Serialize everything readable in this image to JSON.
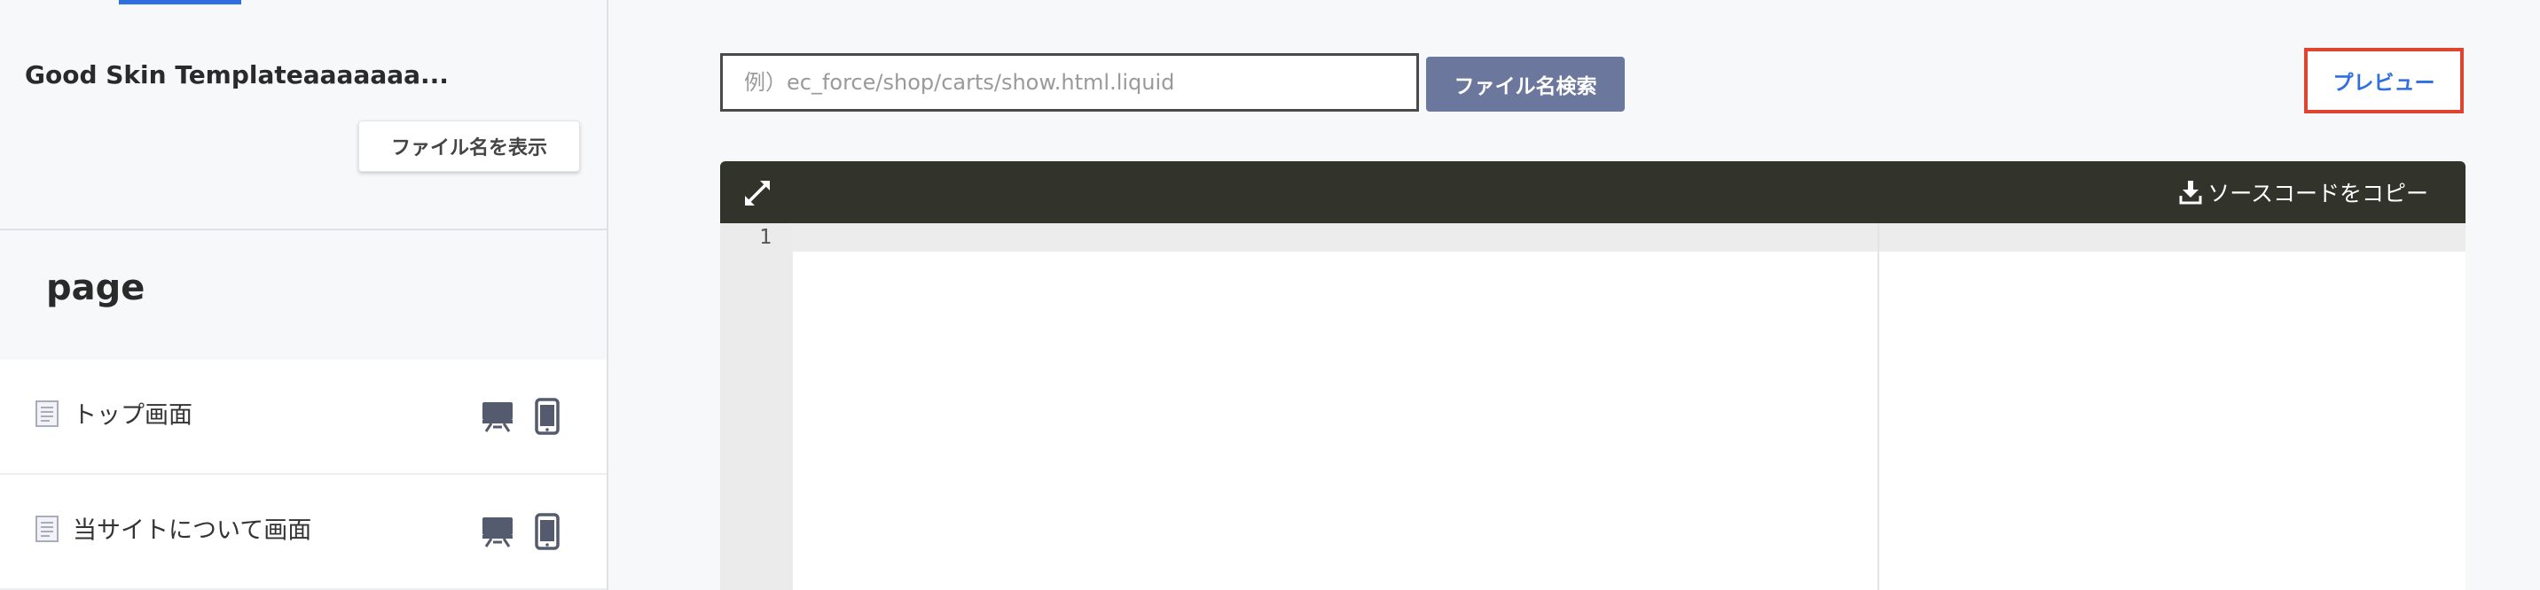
{
  "sidebar": {
    "template_name": "Good Skin Templateaaaaaaa...",
    "show_filenames_label": "ファイル名を表示",
    "section_title": "page",
    "pages": [
      {
        "label": "トップ画面"
      },
      {
        "label": "当サイトについて画面"
      }
    ]
  },
  "search": {
    "placeholder": "例）ec_force/shop/carts/show.html.liquid",
    "button_label": "ファイル名検索"
  },
  "preview_label": "プレビュー",
  "editor": {
    "copy_label": "ソースコードをコピー",
    "line_numbers": [
      "1"
    ]
  },
  "colors": {
    "accent_blue": "#2f6fe0",
    "search_button": "#6b779c",
    "highlight_red": "#e0432f",
    "editor_toolbar": "#32332b"
  },
  "icons": {
    "expand": "expand-arrows-icon",
    "download": "download-icon",
    "document": "document-icon",
    "desktop": "desktop-icon",
    "smartphone": "smartphone-icon"
  }
}
